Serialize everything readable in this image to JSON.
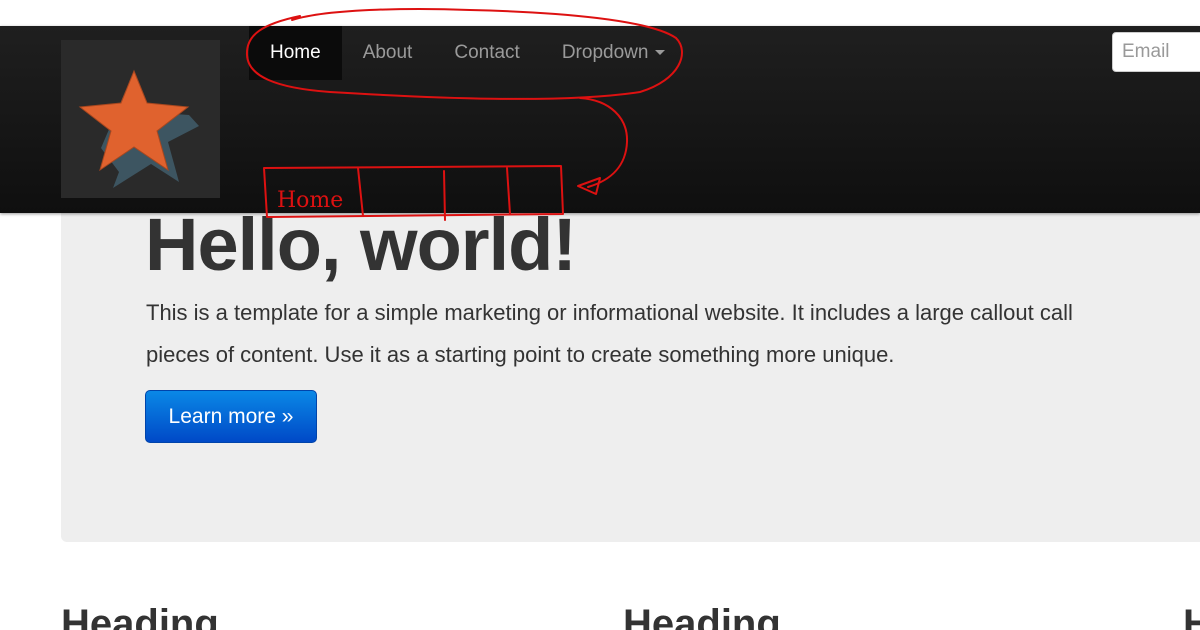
{
  "navbar": {
    "logo_icon": "star-logo-icon",
    "items": [
      {
        "label": "Home",
        "active": true
      },
      {
        "label": "About",
        "active": false
      },
      {
        "label": "Contact",
        "active": false
      },
      {
        "label": "Dropdown",
        "active": false,
        "has_caret": true
      }
    ],
    "email_placeholder": "Email",
    "colors": {
      "background": "#111111",
      "active_text": "#ffffff",
      "text": "#9a9a9a"
    }
  },
  "hero": {
    "title": "Hello, world!",
    "text_line1": "This is a template for a simple marketing or informational website. It includes a large callout call",
    "text_line2": "pieces of content. Use it as a starting point to create something more unique.",
    "button_label": "Learn more »",
    "button_color": "#0055cc"
  },
  "columns": {
    "headings": [
      "Heading",
      "Heading",
      "H"
    ]
  },
  "annotation": {
    "color": "#dd1111",
    "sketch_label": "Home"
  }
}
